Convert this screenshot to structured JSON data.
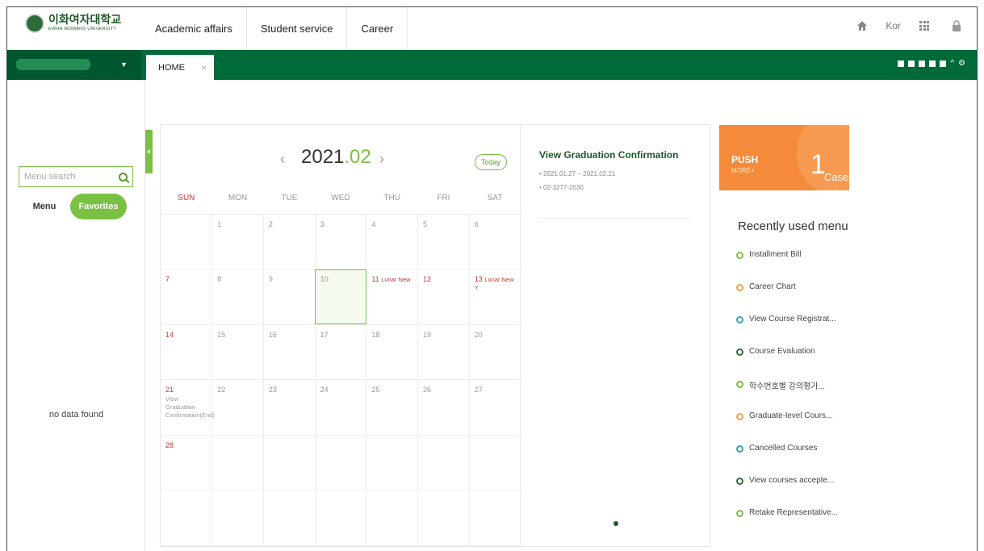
{
  "header": {
    "logo_kr": "이화여자대학교",
    "logo_en": "EWHA WOMANS UNIVERSITY",
    "nav": [
      "Academic affairs",
      "Student service",
      "Career"
    ],
    "lang": "Kor"
  },
  "tabs": {
    "home": "HOME",
    "close": "×"
  },
  "sidebar": {
    "search_placeholder": "Menu search",
    "tab_menu": "Menu",
    "tab_favorites": "Favorites",
    "empty": "no data found"
  },
  "calendar": {
    "prev": "‹",
    "next": "›",
    "year": "2021",
    "month": ".02",
    "today_label": "Today",
    "weekdays": [
      "SUN",
      "MON",
      "TUE",
      "WED",
      "THU",
      "FRI",
      "SAT"
    ],
    "weeks": [
      [
        {
          "d": ""
        },
        {
          "d": "1"
        },
        {
          "d": "2"
        },
        {
          "d": "3"
        },
        {
          "d": "4"
        },
        {
          "d": "5"
        },
        {
          "d": "6"
        }
      ],
      [
        {
          "d": "7",
          "red": true
        },
        {
          "d": "8"
        },
        {
          "d": "9"
        },
        {
          "d": "10",
          "today": true
        },
        {
          "d": "11",
          "red": true,
          "note": "Lunar New"
        },
        {
          "d": "12",
          "red": true
        },
        {
          "d": "13",
          "red": true,
          "note": "Lunar New Y"
        }
      ],
      [
        {
          "d": "14",
          "red": true
        },
        {
          "d": "15"
        },
        {
          "d": "16"
        },
        {
          "d": "17"
        },
        {
          "d": "18"
        },
        {
          "d": "19"
        },
        {
          "d": "20"
        }
      ],
      [
        {
          "d": "21",
          "red": true,
          "event": "View Graduation Confirmation(End)"
        },
        {
          "d": "22"
        },
        {
          "d": "23"
        },
        {
          "d": "24"
        },
        {
          "d": "25"
        },
        {
          "d": "26"
        },
        {
          "d": "27"
        }
      ],
      [
        {
          "d": "28",
          "red": true
        },
        {
          "d": ""
        },
        {
          "d": ""
        },
        {
          "d": ""
        },
        {
          "d": ""
        },
        {
          "d": ""
        },
        {
          "d": ""
        }
      ],
      [
        {
          "d": ""
        },
        {
          "d": ""
        },
        {
          "d": ""
        },
        {
          "d": ""
        },
        {
          "d": ""
        },
        {
          "d": ""
        },
        {
          "d": ""
        }
      ]
    ]
  },
  "detail": {
    "title": "View Graduation Confirmation",
    "period": "• 2021.01.27 ~ 2021.02.21",
    "phone": "• 02-3277-2030"
  },
  "push": {
    "title": "PUSH",
    "more": "MORE+",
    "count": "1",
    "unit": "Case"
  },
  "recent": {
    "title": "Recently used menu",
    "items": [
      {
        "label": "Installment Bill",
        "color": "#7ac143"
      },
      {
        "label": "Career Chart",
        "color": "#f0a040"
      },
      {
        "label": "View Course Registrat...",
        "color": "#3aa0b8"
      },
      {
        "label": "Course Evaluation",
        "color": "#2f6b3a"
      },
      {
        "label": "학수번호별 강의평가...",
        "color": "#7ac143"
      },
      {
        "label": "Graduate-level Cours...",
        "color": "#f0a040"
      },
      {
        "label": "Cancelled Courses",
        "color": "#3aa0b8"
      },
      {
        "label": "View courses accepte...",
        "color": "#2f6b3a"
      },
      {
        "label": "Retake Representative...",
        "color": "#7ac143"
      }
    ]
  }
}
